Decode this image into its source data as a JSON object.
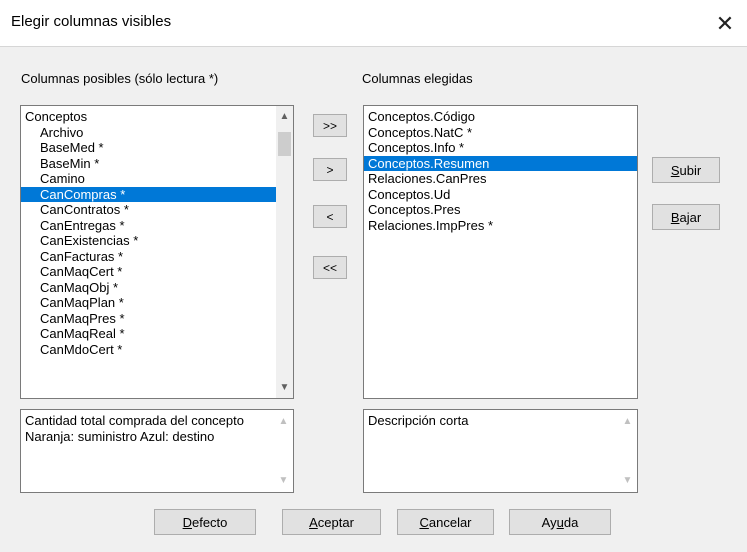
{
  "window": {
    "title": "Elegir columnas visibles"
  },
  "left": {
    "label": "Columnas posibles (sólo lectura *)",
    "items": [
      {
        "text": "Conceptos",
        "indent": false,
        "selected": false
      },
      {
        "text": "Archivo",
        "indent": true,
        "selected": false
      },
      {
        "text": "BaseMed *",
        "indent": true,
        "selected": false
      },
      {
        "text": "BaseMin *",
        "indent": true,
        "selected": false
      },
      {
        "text": "Camino",
        "indent": true,
        "selected": false
      },
      {
        "text": "CanCompras *",
        "indent": true,
        "selected": true
      },
      {
        "text": "CanContratos *",
        "indent": true,
        "selected": false
      },
      {
        "text": "CanEntregas *",
        "indent": true,
        "selected": false
      },
      {
        "text": "CanExistencias *",
        "indent": true,
        "selected": false
      },
      {
        "text": "CanFacturas *",
        "indent": true,
        "selected": false
      },
      {
        "text": "CanMaqCert *",
        "indent": true,
        "selected": false
      },
      {
        "text": "CanMaqObj *",
        "indent": true,
        "selected": false
      },
      {
        "text": "CanMaqPlan *",
        "indent": true,
        "selected": false
      },
      {
        "text": "CanMaqPres *",
        "indent": true,
        "selected": false
      },
      {
        "text": "CanMaqReal *",
        "indent": true,
        "selected": false
      },
      {
        "text": "CanMdoCert *",
        "indent": true,
        "selected": false
      }
    ],
    "description": "Cantidad total comprada del concepto Naranja: suministro Azul: destino"
  },
  "right": {
    "label": "Columnas elegidas",
    "items": [
      {
        "text": "Conceptos.Código",
        "selected": false
      },
      {
        "text": "Conceptos.NatC *",
        "selected": false
      },
      {
        "text": "Conceptos.Info *",
        "selected": false
      },
      {
        "text": "Conceptos.Resumen",
        "selected": true
      },
      {
        "text": "Relaciones.CanPres",
        "selected": false
      },
      {
        "text": "Conceptos.Ud",
        "selected": false
      },
      {
        "text": "Conceptos.Pres",
        "selected": false
      },
      {
        "text": "Relaciones.ImpPres *",
        "selected": false
      }
    ],
    "description": "Descripción corta"
  },
  "transfer": {
    "add_all": ">>",
    "add": ">",
    "remove": "<",
    "remove_all": "<<"
  },
  "order": {
    "up_pre": "",
    "up_key": "S",
    "up_post": "ubir",
    "down_pre": "",
    "down_key": "B",
    "down_post": "ajar"
  },
  "footer": {
    "default_pre": "",
    "default_key": "D",
    "default_post": "efecto",
    "accept_pre": "",
    "accept_key": "A",
    "accept_post": "ceptar",
    "cancel_pre": "",
    "cancel_key": "C",
    "cancel_post": "ancelar",
    "help_pre": "Ay",
    "help_key": "u",
    "help_post": "da"
  },
  "colors": {
    "selection": "#0078d7",
    "window_bg": "#f0f0f0"
  }
}
